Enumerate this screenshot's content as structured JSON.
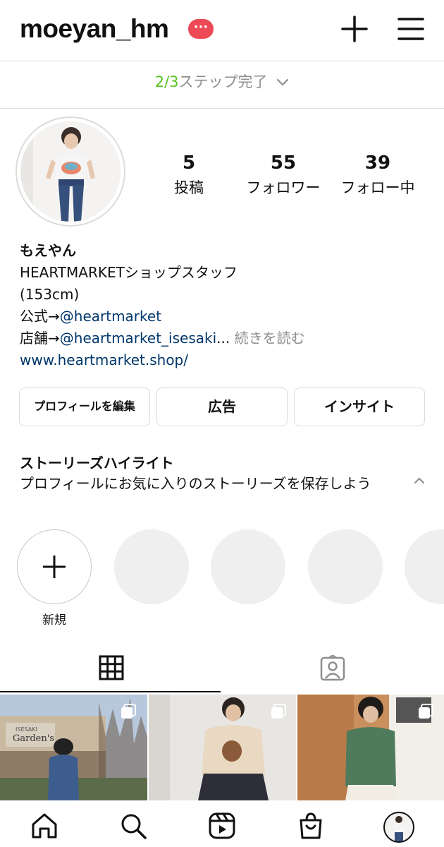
{
  "header": {
    "username": "moeyan_hm",
    "notification_badge": "···",
    "new_post_icon": "plus-icon",
    "menu_icon": "hamburger-menu-icon"
  },
  "steps": {
    "progress": "2/3",
    "label": "ステップ完了"
  },
  "profile": {
    "stats": [
      {
        "value": "5",
        "label": "投稿"
      },
      {
        "value": "55",
        "label": "フォロワー"
      },
      {
        "value": "39",
        "label": "フォロー中"
      }
    ],
    "name": "もえやん",
    "bio_line1": "HEARTMARKETショップスタッフ",
    "bio_line2": "(153cm)",
    "bio_line3_prefix": "公式→",
    "bio_line3_link": "@heartmarket",
    "bio_line4_prefix": "店舗→",
    "bio_line4_link": "@heartmarket_isesaki",
    "bio_line4_ellipsis": "...",
    "more_label": "続きを読む",
    "website": "www.heartmarket.shop/"
  },
  "buttons": {
    "edit_profile": "プロフィールを編集",
    "ads": "広告",
    "insights": "インサイト"
  },
  "highlights": {
    "title": "ストーリーズハイライト",
    "description": "プロフィールにお気に入りのストーリーズを保存しよう",
    "new_label": "新規"
  },
  "tabs": {
    "grid_icon": "grid-icon",
    "tagged_icon": "tagged-person-icon"
  },
  "photos": {
    "sign_text": "Garden's",
    "sign_small": "ISESAKI"
  },
  "nav": {
    "icons": [
      "home-icon",
      "search-icon",
      "reels-icon",
      "shop-icon",
      "profile-avatar"
    ]
  },
  "colors": {
    "accent_green": "#58c322",
    "badge_red": "#ed4956",
    "link_blue": "#00376b",
    "muted_gray": "#8e8e8e"
  }
}
